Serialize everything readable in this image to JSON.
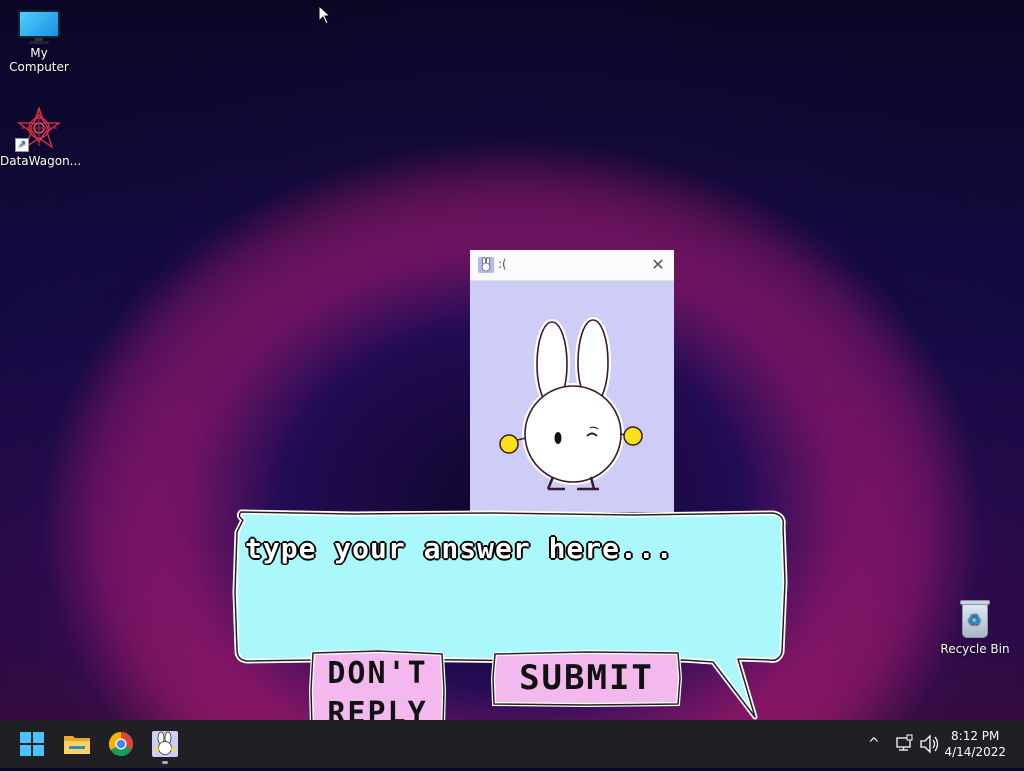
{
  "desktop": {
    "icons": [
      {
        "label": "My Computer"
      },
      {
        "label": "DataWagon..."
      },
      {
        "label": "Recycle Bin"
      }
    ]
  },
  "dialog": {
    "title": ":(",
    "close_glyph": "✕"
  },
  "bubble": {
    "placeholder": "type your answer here...",
    "value": ""
  },
  "buttons": {
    "dont_reply": "DON'T REPLY",
    "dont_line1": "DON'T",
    "dont_line2": "REPLY",
    "submit": "SUBMIT"
  },
  "taskbar": {
    "apps": [
      "start-icon",
      "file-explorer-icon",
      "chrome-icon",
      "bunny-app-icon"
    ],
    "tray_chevron": "^",
    "time": "8:12 PM",
    "date": "4/14/2022"
  },
  "colors": {
    "bubble_fill": "#aaf8fb",
    "button_fill": "#f3b9ef",
    "dialog_bg": "#cdcdf7",
    "taskbar": "#1f1f24"
  }
}
